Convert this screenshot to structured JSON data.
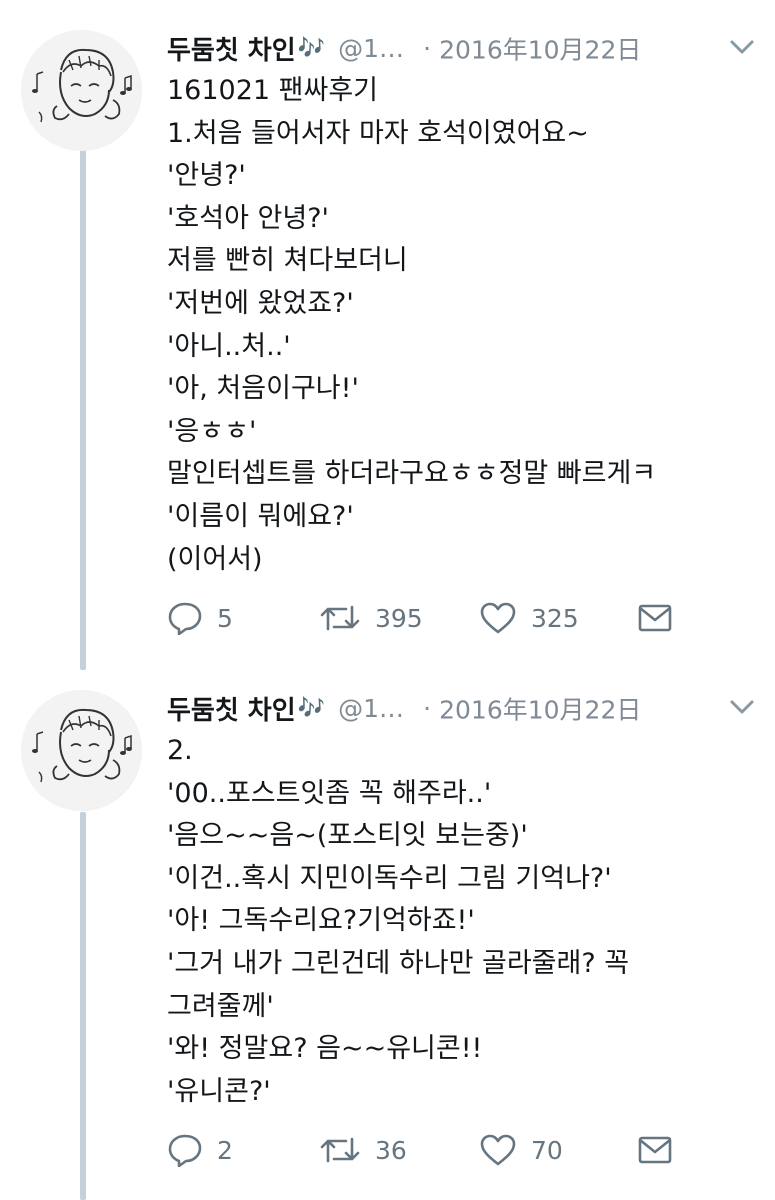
{
  "tweets": [
    {
      "display_name": "두둠칫 차인",
      "name_emoji": "🎶",
      "handle": "@1…",
      "separator": "·",
      "date": "2016年10月22日",
      "lines": [
        "161021 팬싸후기",
        "1.처음 들어서자 마자 호석이였어요~",
        "'안녕?'",
        "'호석아 안녕?'",
        "저를 빤히 쳐다보더니",
        "'저번에 왔었죠?'",
        "'아니..처..'",
        "'아, 처음이구나!'",
        "'응ㅎㅎ'",
        "말인터셉트를 하더라구요ㅎㅎ정말 빠르게ㅋ",
        "'이름이 뭐에요?'",
        "(이어서)"
      ],
      "replies": "5",
      "retweets": "395",
      "likes": "325"
    },
    {
      "display_name": "두둠칫 차인",
      "name_emoji": "🎶",
      "handle": "@1…",
      "separator": "·",
      "date": "2016年10月22日",
      "lines": [
        "2.",
        "'00..포스트잇좀 꼭 해주라..'",
        "'음으~~음~(포스티잇 보는중)'",
        "'이건..혹시 지민이독수리 그림 기억나?'",
        "'아! 그독수리요?기억하죠!'",
        "'그거 내가 그린건데 하나만 골라줄래? 꼭",
        "그려줄께'",
        "'와! 정말요? 음~~유니콘!!",
        "'유니콘?'"
      ],
      "replies": "2",
      "retweets": "36",
      "likes": "70"
    }
  ],
  "icons": {
    "reply": "reply-icon",
    "retweet": "retweet-icon",
    "like": "heart-icon",
    "message": "envelope-icon",
    "caret": "chevron-down-icon",
    "avatar": "avatar-sketch"
  },
  "colors": {
    "text": "#14171a",
    "secondary": "#7f8a94",
    "action": "#66757f",
    "thread_line": "#c4d0da",
    "emoji": "#e0245e"
  }
}
